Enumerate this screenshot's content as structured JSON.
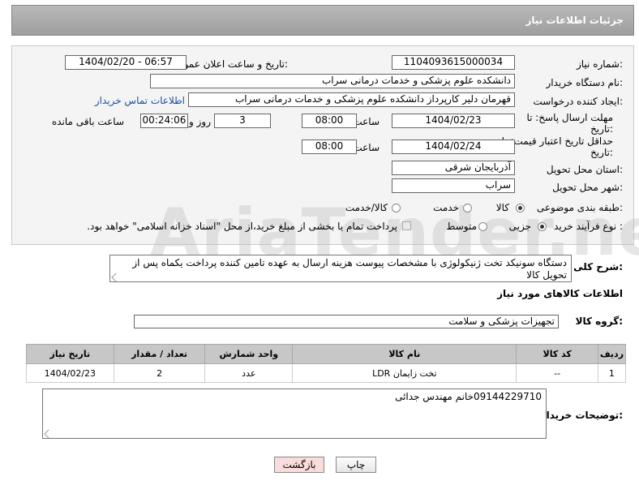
{
  "header": {
    "title": "جزئیات اطلاعات نیاز"
  },
  "watermark": "AriaTender.net",
  "fields": {
    "need_number_label": "شماره نیاز:",
    "need_number": "1104093615000034",
    "announce_label": "تاریخ و ساعت اعلان عمومی:",
    "announce_value": "1404/02/20 - 06:57",
    "buyer_org_label": "نام دستگاه خریدار:",
    "buyer_org": "دانشکده علوم پزشکی و خدمات درمانی سراب",
    "requester_label": "ایجاد کننده درخواست:",
    "requester": "قهرمان دلیر کارپرداز دانشکده علوم پزشکی و خدمات درمانی سراب",
    "buyer_contact_link": "اطلاعات تماس خریدار",
    "reply_deadline_label": "مهلت ارسال پاسخ: تا تاریخ:",
    "reply_date": "1404/02/23",
    "time_label": "ساعت",
    "reply_time": "08:00",
    "reply_days": "3",
    "days_label": "روز و",
    "remaining_time": "00:24:06",
    "remaining_label": "ساعت باقی مانده",
    "price_validity_label": "حداقل تاریخ اعتبار قیمت: تا تاریخ:",
    "price_date": "1404/02/24",
    "price_time": "08:00",
    "province_label": "استان محل تحویل:",
    "province": "آذربایجان شرقی",
    "city_label": "شهر محل تحویل:",
    "city": "سراب",
    "category_label": "طبقه بندی موضوعی:",
    "category_options": [
      "کالا",
      "خدمت",
      "کالا/خدمت"
    ],
    "category_selected": "کالا",
    "process_label": "نوع فرآیند خرید :",
    "process_options": [
      "جزیی",
      "متوسط"
    ],
    "process_selected": "جزیی",
    "payment_note": "پرداخت تمام یا بخشی از مبلغ خرید،از محل \"اسناد خزانه اسلامی\" خواهد بود."
  },
  "description": {
    "label": "شرح کلی نیاز:",
    "text": "دستگاه سونیکد تخت ژنیکولوژی با مشخصات پیوست هزینه ارسال به عهده تامین کننده پرداخت یکماه پس از تحویل کالا"
  },
  "goods_section": {
    "title": "اطلاعات کالاهای مورد نیاز",
    "group_label": "گروه کالا:",
    "group_value": "تجهیزات پزشکی و سلامت"
  },
  "table": {
    "headers": [
      "ردیف",
      "کد کالا",
      "نام کالا",
      "واحد شمارش",
      "تعداد / مقدار",
      "تاریخ نیاز"
    ],
    "rows": [
      [
        "1",
        "--",
        "تخت زایمان LDR",
        "عدد",
        "2",
        "1404/02/23"
      ]
    ]
  },
  "buyer_notes": {
    "label": "توضیحات خریدار:",
    "text": "09144229710خانم مهندس جدائی"
  },
  "buttons": {
    "print": "چاپ",
    "back": "بازگشت"
  }
}
